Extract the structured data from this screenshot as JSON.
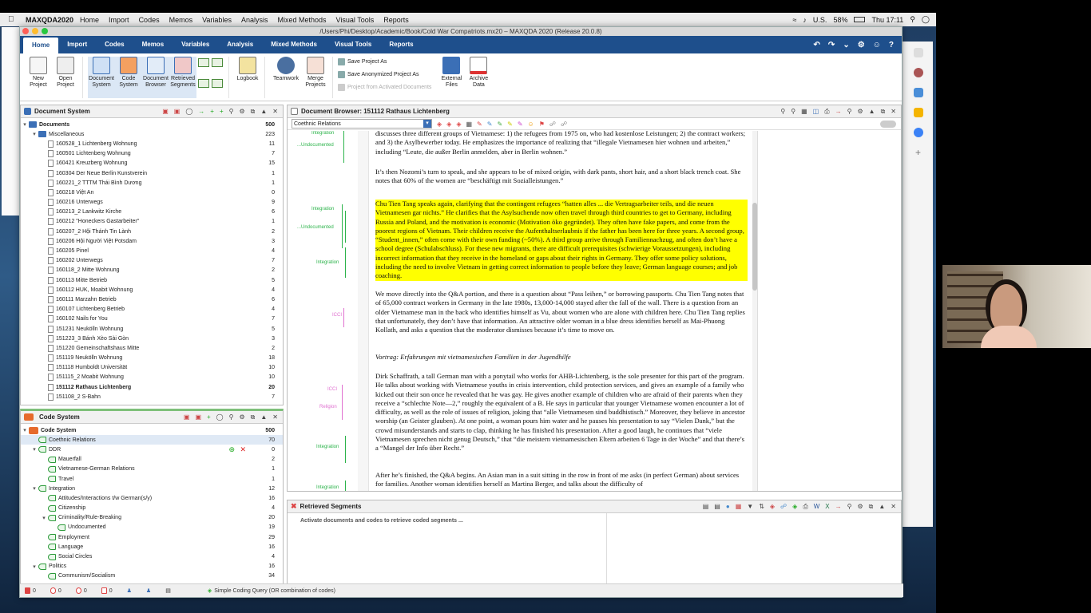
{
  "menubar": {
    "app_name": "MAXQDA2020",
    "items": [
      "Home",
      "Import",
      "Codes",
      "Memos",
      "Variables",
      "Analysis",
      "Mixed Methods",
      "Visual Tools",
      "Reports"
    ],
    "battery": "58%",
    "keyboard": "U.S.",
    "clock": "Thu 17:11"
  },
  "window": {
    "title": "/Users/Phi/Desktop/Academic/Book/Cold War Compatriots.mx20 – MAXQDA 2020 (Release 20.0.8)"
  },
  "ribbon": {
    "tabs": [
      "Home",
      "Import",
      "Codes",
      "Memos",
      "Variables",
      "Analysis",
      "Mixed Methods",
      "Visual Tools",
      "Reports"
    ],
    "active_tab": "Home",
    "buttons": [
      {
        "label": "New Project",
        "icon": "new-project-icon"
      },
      {
        "label": "Open Project",
        "icon": "open-project-icon"
      },
      {
        "label": "Document System",
        "icon": "document-system-icon"
      },
      {
        "label": "Code System",
        "icon": "code-system-icon"
      },
      {
        "label": "Document Browser",
        "icon": "document-browser-icon"
      },
      {
        "label": "Retrieved Segments",
        "icon": "retrieved-segments-icon"
      },
      {
        "label": "Logbook",
        "icon": "logbook-icon"
      },
      {
        "label": "Teamwork",
        "icon": "teamwork-icon"
      },
      {
        "label": "Merge Projects",
        "icon": "merge-projects-icon"
      }
    ],
    "small": [
      "Save Project As",
      "Save Anonymized Project As",
      "Project from Activated Documents"
    ],
    "buttons2": [
      {
        "label": "External Files",
        "icon": "external-files-icon"
      },
      {
        "label": "Archive Data",
        "icon": "archive-data-icon"
      }
    ]
  },
  "document_system": {
    "title": "Document System",
    "root": {
      "label": "Documents",
      "count": "500"
    },
    "folder": {
      "label": "Miscellaneous",
      "count": "223"
    },
    "docs": [
      {
        "label": "160528_1 Lichtenberg Wohnung",
        "count": "11"
      },
      {
        "label": "160501 Lichtenberg Wohnung",
        "count": "7"
      },
      {
        "label": "160421 Kreuzberg Wohnung",
        "count": "15"
      },
      {
        "label": "160304 Der Neue Berlin Kunstverein",
        "count": "1"
      },
      {
        "label": "160221_2 TTTM Thái Bình Dương",
        "count": "1"
      },
      {
        "label": "160218 Việt An",
        "count": "0"
      },
      {
        "label": "160216 Unterwegs",
        "count": "9"
      },
      {
        "label": "160213_2 Lankwitz Kirche",
        "count": "6"
      },
      {
        "label": "160212 \"Honeckers Gastarbeiter\"",
        "count": "1"
      },
      {
        "label": "160207_2 Hội Thánh Tin Lành",
        "count": "2"
      },
      {
        "label": "160206 Hội Người Việt Potsdam",
        "count": "3"
      },
      {
        "label": "160205 Pinel",
        "count": "4"
      },
      {
        "label": "160202 Unterwegs",
        "count": "7"
      },
      {
        "label": "160118_2 Mitte Wohnung",
        "count": "2"
      },
      {
        "label": "160113 Mitte Betrieb",
        "count": "5"
      },
      {
        "label": "160112 HUK, Moabit Wohnung",
        "count": "4"
      },
      {
        "label": "160111 Marzahn Betrieb",
        "count": "6"
      },
      {
        "label": "160107 Lichtenberg Betrieb",
        "count": "4"
      },
      {
        "label": "160102 Nails for You",
        "count": "7"
      },
      {
        "label": "151231 Neukölln Wohnung",
        "count": "5"
      },
      {
        "label": "151223_3 Bánh Xèo Sài Gòn",
        "count": "3"
      },
      {
        "label": "151220 Gemeinschaftshaus Mitte",
        "count": "2"
      },
      {
        "label": "151119 Neukölln Wohnung",
        "count": "18"
      },
      {
        "label": "151118 Humboldt Universität",
        "count": "10"
      },
      {
        "label": "151115_2 Moabit Wohnung",
        "count": "10"
      },
      {
        "label": "151112 Rathaus Lichtenberg",
        "count": "20"
      },
      {
        "label": "151108_2 S-Bahn",
        "count": "7"
      }
    ]
  },
  "code_system": {
    "title": "Code System",
    "root": {
      "label": "Code System",
      "count": "500"
    },
    "codes": [
      {
        "label": "Coethnic Relations",
        "count": "70",
        "level": 1,
        "expand": ""
      },
      {
        "label": "DDR",
        "count": "0",
        "level": 1,
        "expand": "v"
      },
      {
        "label": "Mauerfall",
        "count": "2",
        "level": 2,
        "expand": ""
      },
      {
        "label": "Vietnamese-German Relations",
        "count": "1",
        "level": 2,
        "expand": ""
      },
      {
        "label": "Travel",
        "count": "1",
        "level": 2,
        "expand": ""
      },
      {
        "label": "Integration",
        "count": "12",
        "level": 1,
        "expand": "v"
      },
      {
        "label": "Attitudes/Interactions t/w German(s/y)",
        "count": "16",
        "level": 2,
        "expand": ""
      },
      {
        "label": "Citizenship",
        "count": "4",
        "level": 2,
        "expand": ""
      },
      {
        "label": "Criminality/Rule-Breaking",
        "count": "20",
        "level": 2,
        "expand": "v"
      },
      {
        "label": "Undocumented",
        "count": "19",
        "level": 3,
        "expand": ""
      },
      {
        "label": "Employment",
        "count": "29",
        "level": 2,
        "expand": ""
      },
      {
        "label": "Language",
        "count": "16",
        "level": 2,
        "expand": ""
      },
      {
        "label": "Social Circles",
        "count": "4",
        "level": 2,
        "expand": ""
      },
      {
        "label": "Politics",
        "count": "16",
        "level": 1,
        "expand": "v"
      },
      {
        "label": "Communism/Socialism",
        "count": "34",
        "level": 2,
        "expand": ""
      }
    ]
  },
  "document_browser": {
    "title": "Document Browser: 151112 Rathaus Lichtenberg",
    "code_dropdown": "Coethnic Relations",
    "paragraphs": [
      {
        "num": "",
        "text": "discusses three different groups of Vietnamese: 1) the refugees from 1975 on, who had kostenlose Leistungen; 2) the contract workers; and 3) the Asylbewerber today. He emphasizes the importance of realizing that “illegale Vietnamesen hier wohnen und arbeiten,” including “Leute, die außer Berlin anmelden, aber in Berlin wohnen.”"
      },
      {
        "num": "7",
        "text": "It’s then Nozomi’s turn to speak, and she appears to be of mixed origin, with dark pants, short hair, and a short black trench coat. She notes that 60% of the women are “beschäftigt mit Sozialleistungen.”"
      },
      {
        "num": "8",
        "text": "Chu Tien Tang speaks again, clarifying that the contingent refugees “hatten alles ... die Vertragsarbeiter teils, und die neuen Vietnamesen gar nichts.” He clarifies that the Asylsuchende now often travel through third countries to get to Germany, including Russia and Poland, and the motivation is economic (Motivation öko gegründet). They often have fake papers, and come from the poorest regions of Vietnam. Their children receive the Aufenthaltserlaubnis if the father has been here for three years. A second group, “Student_innen,” often come with their own funding (~50%). A third group arrive through Familiennachzug, and often don’t have a school degree (Schulabschluss). For these new migrants, there are difficult prerequisites (schwierige Voraussetzungen), including incorrect information that they receive in the homeland or gaps about their rights in Germany. They offer some policy solutions, including the need to involve Vietnam in getting correct information to people before they leave; German language courses; and job coaching."
      },
      {
        "num": "9",
        "text": "We move directly into the Q&A portion, and there is a question about “Pass leihen,” or borrowing passports. Chu Tien Tang notes that of 65,000 contract workers in Germany in the late 1980s, 13,000-14,000 stayed after the fall of the wall. There is a question from an older Vietnamese man in the back who identifies himself as Vu, about women who are alone with children here. Chu Tien Tang replies that unfortunately, they don’t have that information. An attractive older woman in a blue dress identifies herself as Mai-Phuong Kollath, and asks a question that the moderator dismisses because it’s time to move on."
      },
      {
        "num": "10",
        "text": "Vortrag: Erfahrungen mit vietnamesischen Familien in der Jugendhilfe"
      },
      {
        "num": "11",
        "text": "Dirk Schaffrath, a tall German man with a ponytail who works for AHB-Lichtenberg, is the sole presenter for this part of the program. He talks about working with Vietnamese youths in crisis intervention, child protection services, and gives an example of a family who kicked out their son once he revealed that he was gay. He gives another example of children who are afraid of their parents when they receive a “schlechte Note—2,” roughly the equivalent of a B. He says in particular that younger Vietnamese women encounter a lot of difficulty, as well as the role of issues of religion, joking that “alle Vietnamesen sind buddhistisch.” Moreover, they believe in ancestor worship (an Geister glauben). At one point, a woman pours him water and he pauses his presentation to say “Vielen Dank,” but the crowd misunderstands and starts to clap, thinking he has finished his presentation. After a good laugh, he continues that “viele Vietnamesen sprechen nicht genug Deutsch,” that “die meistern vietnamesischen Eltern arbeiten 6 Tage in der Woche” and that there’s a “Mangel der Info über Recht.”"
      },
      {
        "num": "12",
        "text": "After he’s finished, the Q&A begins. An Asian man in a suit sitting in the row in front of me asks (in perfect German) about services for families. Another woman identifies herself as Martina Berger, and talks about the difficulty of"
      }
    ],
    "code_marks": [
      {
        "label": "Integration",
        "color": "#2bb34a"
      },
      {
        "label": "...Undocumented",
        "color": "#2bb34a"
      },
      {
        "label": "Integration",
        "color": "#2bb34a"
      },
      {
        "label": "...Undocumented",
        "color": "#2bb34a"
      },
      {
        "label": "Integration",
        "color": "#2bb34a"
      },
      {
        "label": "ICCI",
        "color": "#e070d0"
      },
      {
        "label": "ICCI",
        "color": "#e070d0"
      },
      {
        "label": "Religion",
        "color": "#e070d0"
      },
      {
        "label": "Integration",
        "color": "#2bb34a"
      },
      {
        "label": "Integration",
        "color": "#2bb34a"
      }
    ]
  },
  "retrieved_segments": {
    "title": "Retrieved Segments",
    "hint": "Activate documents and codes to retrieve coded segments ..."
  },
  "statusbar": {
    "items": [
      "0",
      "0",
      "0",
      "0"
    ],
    "query": "Simple Coding Query (OR combination of codes)"
  },
  "colors": {
    "ribbon_blue": "#1e4f8c",
    "highlight": "#ffff00",
    "code_green": "#2bb34a",
    "code_pink": "#e070d0"
  }
}
